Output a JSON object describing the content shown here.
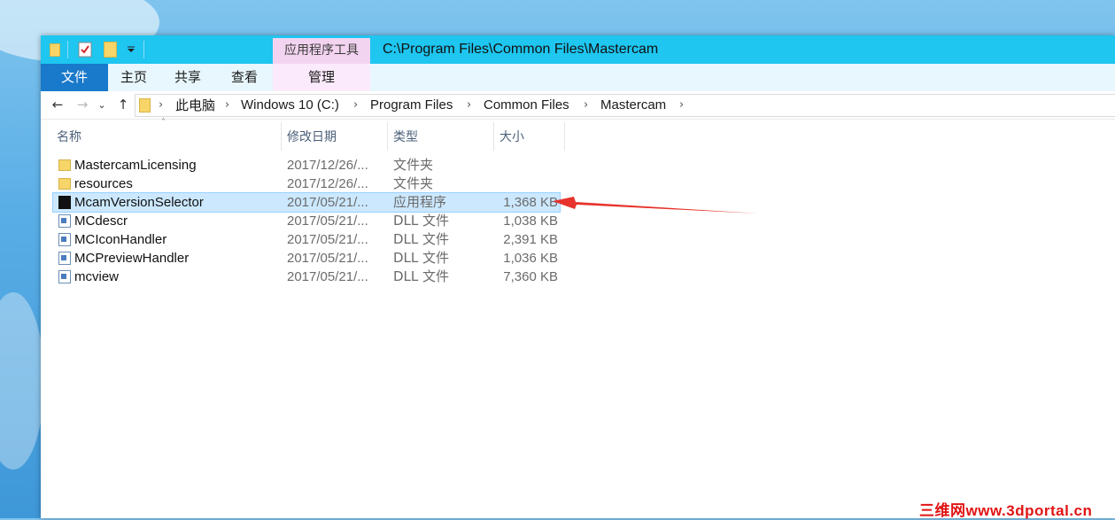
{
  "window": {
    "title_path": "C:\\Program Files\\Common Files\\Mastercam",
    "context_group": "应用程序工具"
  },
  "ribbon": {
    "tabs": [
      {
        "label": "文件",
        "active": true
      },
      {
        "label": "主页"
      },
      {
        "label": "共享"
      },
      {
        "label": "查看"
      },
      {
        "label": "管理",
        "contextual": true
      }
    ]
  },
  "address": {
    "crumbs": [
      "此电脑",
      "Windows 10 (C:)",
      "Program Files",
      "Common Files",
      "Mastercam"
    ]
  },
  "columns": {
    "name": "名称",
    "date": "修改日期",
    "type": "类型",
    "size": "大小"
  },
  "files": [
    {
      "name": "MastercamLicensing",
      "date": "2017/12/26/...",
      "type": "文件夹",
      "size": "",
      "icon": "folder-icon"
    },
    {
      "name": "resources",
      "date": "2017/12/26/...",
      "type": "文件夹",
      "size": "",
      "icon": "folder-icon"
    },
    {
      "name": "McamVersionSelector",
      "date": "2017/05/21/...",
      "type": "应用程序",
      "size": "1,368 KB",
      "icon": "application-icon",
      "selected": true
    },
    {
      "name": "MCdescr",
      "date": "2017/05/21/...",
      "type": "DLL 文件",
      "size": "1,038 KB",
      "icon": "dll-file-icon"
    },
    {
      "name": "MCIconHandler",
      "date": "2017/05/21/...",
      "type": "DLL 文件",
      "size": "2,391 KB",
      "icon": "dll-file-icon"
    },
    {
      "name": "MCPreviewHandler",
      "date": "2017/05/21/...",
      "type": "DLL 文件",
      "size": "1,036 KB",
      "icon": "dll-file-icon"
    },
    {
      "name": "mcview",
      "date": "2017/05/21/...",
      "type": "DLL 文件",
      "size": "7,360 KB",
      "icon": "dll-file-icon"
    }
  ],
  "annotation": {
    "color": "#e8322c"
  },
  "watermark": "三维网www.3dportal.cn",
  "colors": {
    "titlebar": "#1ec6f0",
    "file_tab": "#1979ca",
    "context_tab": "#f3d4f0",
    "selection": "#cce8ff"
  }
}
